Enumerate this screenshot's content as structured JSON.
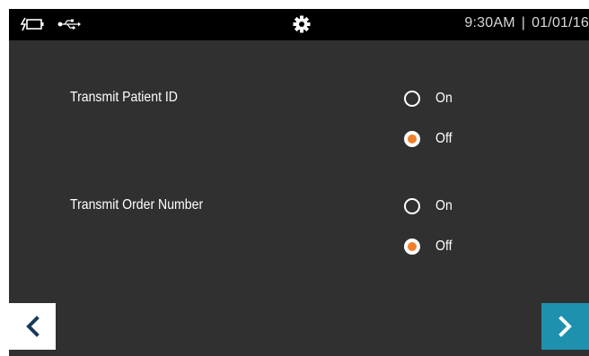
{
  "status_bar": {
    "time": "9:30AM",
    "separator": "|",
    "date": "01/01/16",
    "icons": [
      "battery-charging-icon",
      "usb-icon",
      "gear-icon"
    ]
  },
  "settings": [
    {
      "label": "Transmit Patient ID",
      "options": [
        {
          "label": "On",
          "selected": false
        },
        {
          "label": "Off",
          "selected": true
        }
      ]
    },
    {
      "label": "Transmit Order Number",
      "options": [
        {
          "label": "On",
          "selected": false
        },
        {
          "label": "Off",
          "selected": true
        }
      ]
    }
  ],
  "navigation": {
    "back_icon": "chevron-left-icon",
    "next_icon": "chevron-right-icon"
  },
  "colors": {
    "background": "#303030",
    "status_bar": "#000000",
    "radio_selected": "#f07f2a",
    "next_button": "#1d91ad",
    "back_button": "#ffffff",
    "chevron_dark": "#1a3a5a"
  }
}
